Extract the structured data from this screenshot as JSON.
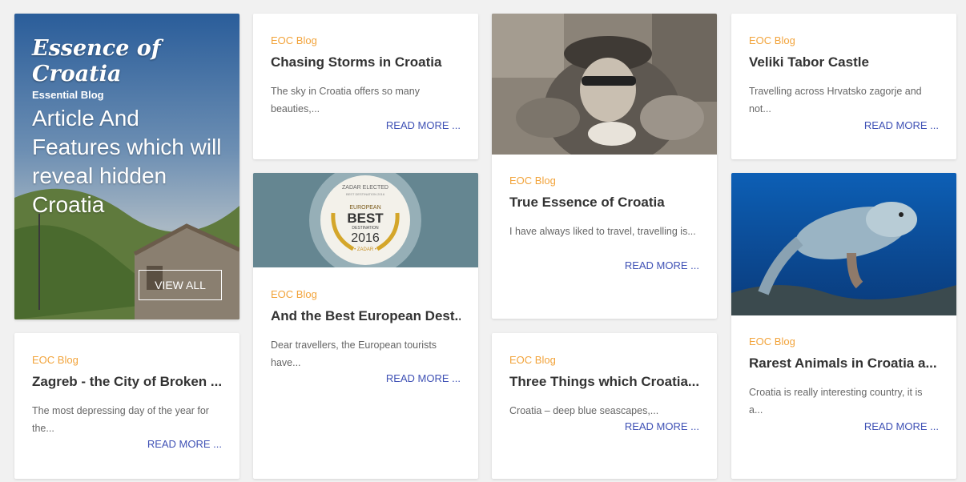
{
  "hero": {
    "logo": "Essence of Croatia",
    "subtitle": "Essential Blog",
    "headline": "Article And Features which will reveal hidden Croatia",
    "button": "VIEW ALL"
  },
  "read_more": "READ MORE ...",
  "posts": [
    {
      "category": "EOC Blog",
      "title": "Chasing Storms in Croatia",
      "excerpt": "The sky in Croatia offers so many beauties,..."
    },
    {
      "category": "EOC Blog",
      "title": "Veliki Tabor Castle",
      "excerpt": "Travelling across Hrvatsko zagorje and not..."
    },
    {
      "category": "EOC Blog",
      "title": "True Essence of Croatia",
      "excerpt": "I have always liked to travel, travelling is..."
    },
    {
      "category": "EOC Blog",
      "title": "And the Best European Dest...",
      "excerpt": "Dear travellers, the European tourists have..."
    },
    {
      "category": "EOC Blog",
      "title": "Rarest Animals in Croatia a...",
      "excerpt": "Croatia is really interesting country, it is a..."
    },
    {
      "category": "EOC Blog",
      "title": "Zagreb - the City of Broken ...",
      "excerpt": "The most depressing day of the year for the..."
    },
    {
      "category": "EOC Blog",
      "title": "Three Things which Croatia...",
      "excerpt": "Croatia – deep blue seascapes,..."
    }
  ],
  "badge": {
    "top": "ZADAR ELECTED",
    "small": "BEST DESTINATION 2016",
    "european": "EUROPEAN",
    "best": "BEST",
    "destination": "DESTINATION",
    "year": "2016",
    "city": "• ZADAR •"
  }
}
